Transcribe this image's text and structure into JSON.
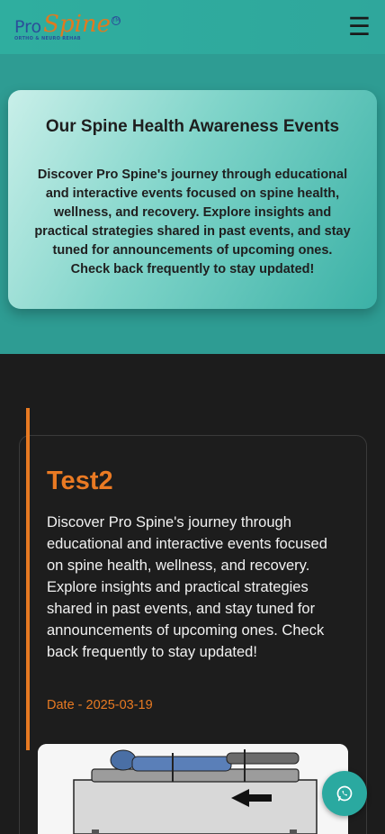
{
  "header": {
    "logo": {
      "pro": "Pro",
      "spine": "Spine",
      "tm": "TM",
      "tagline": "ORTHO & NEURO REHAB"
    },
    "menu_icon": "☰"
  },
  "intro": {
    "title": "Our Spine Health Awareness Events",
    "text": "Discover Pro Spine's journey through educational and interactive events focused on spine health, wellness, and recovery. Explore insights and practical strategies shared in past events, and stay tuned for announcements of upcoming ones. Check back frequently to stay updated!"
  },
  "event": {
    "title": "Test2",
    "description": "Discover Pro Spine's journey through educational and interactive events focused on spine health, wellness, and recovery. Explore insights and practical strategies shared in past events, and stay tuned for announcements of upcoming ones. Check back frequently to stay updated!",
    "date": "Date - 2025-03-19",
    "image_icon": "traction-table-illustration"
  },
  "whatsapp": {
    "icon": "whatsapp-icon"
  },
  "colors": {
    "teal": "#2e9c93",
    "orange": "#e87a22",
    "dark": "#1c1c1c"
  }
}
